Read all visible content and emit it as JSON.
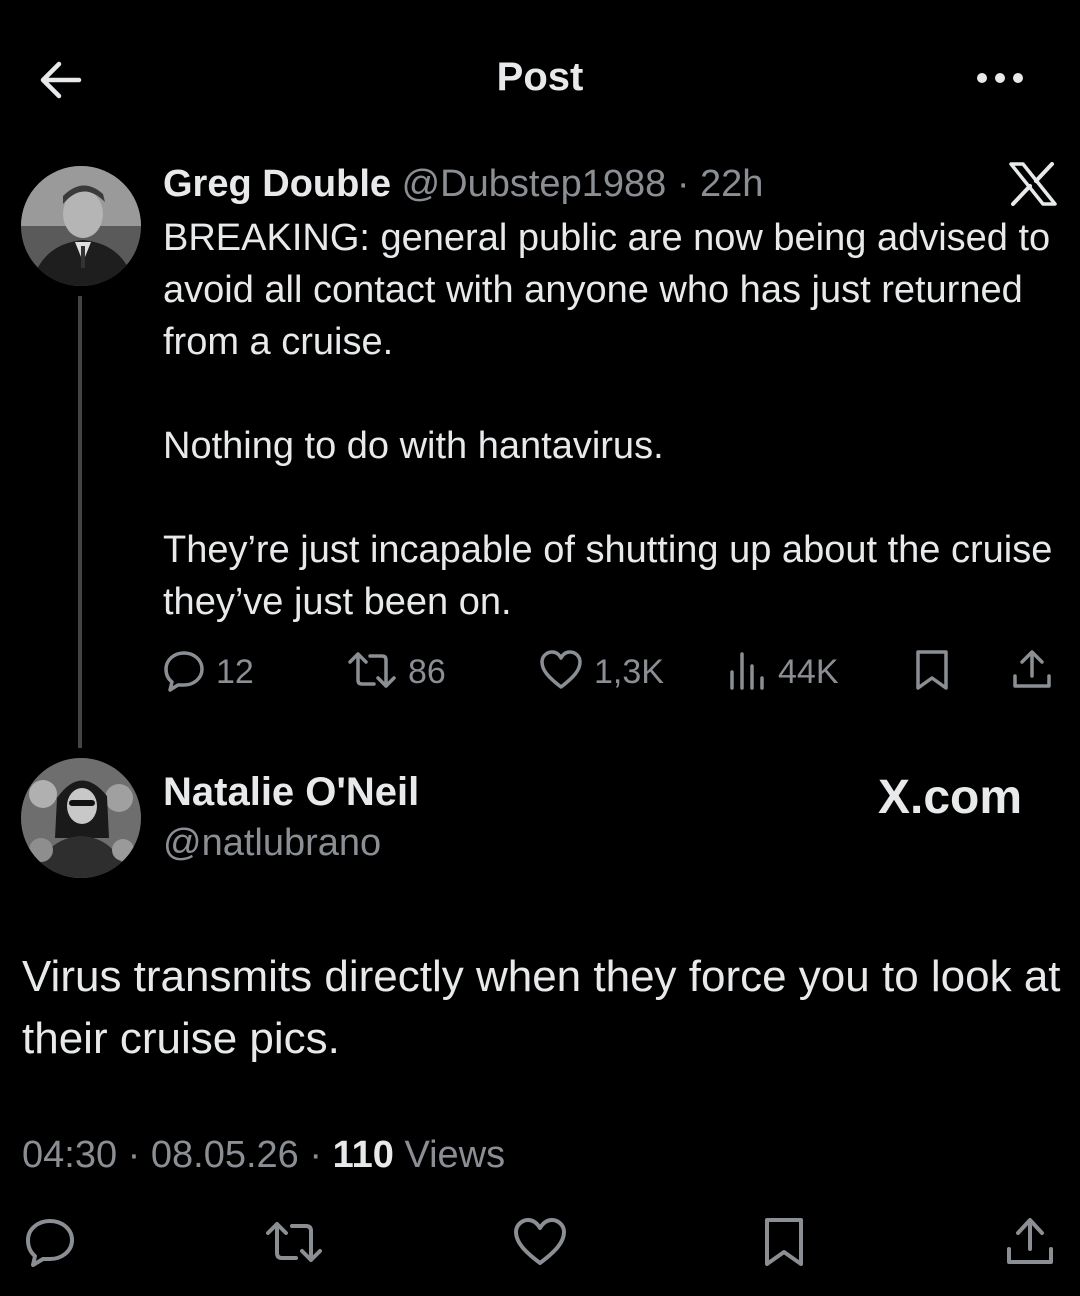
{
  "header": {
    "title": "Post",
    "back_icon": "arrow-left-icon",
    "more_icon": "more-dots-icon"
  },
  "post1": {
    "author_name": "Greg Double",
    "handle": "@Dubstep1988",
    "separator": "·",
    "time": "22h",
    "logo_icon": "x-logo-icon",
    "body": {
      "line1": "BREAKING: general public are now being advised to avoid all contact with anyone who has just returned from a cruise.",
      "line2": "Nothing to do with hantavirus.",
      "line3": "They’re just incapable of shutting up about the cruise they’ve just been on."
    },
    "actions": {
      "replies": "12",
      "reposts": "86",
      "likes": "1,3K",
      "views": "44K"
    }
  },
  "post2": {
    "author_name": "Natalie O'Neil",
    "handle": "@natlubrano",
    "watermark": "X.com",
    "body": {
      "line1": "Virus transmits directly when they force you to look at their cruise pics."
    },
    "meta": {
      "time": "04:30",
      "separator": "·",
      "date": "08.05.26",
      "views_count": "110",
      "views_label": "Views"
    }
  },
  "colors": {
    "background": "#000000",
    "text": "#e7e9ea",
    "secondary_text": "#8b8f94",
    "thread_line": "#444444"
  }
}
